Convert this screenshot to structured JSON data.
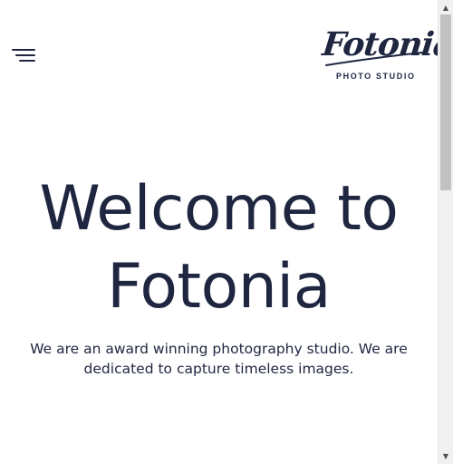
{
  "header": {
    "menu_icon": "hamburger-menu-icon",
    "logo": {
      "name": "Fotonia",
      "tagline": "PHOTO STUDIO"
    }
  },
  "hero": {
    "title_line1": "Welcome to",
    "title_line2": "Fotonia",
    "subtitle_line1": "We are an award winning photography studio. We are",
    "subtitle_line2": "dedicated to capture timeless images."
  },
  "scrollbar": {
    "up_icon": "scroll-up-arrow-icon",
    "down_icon": "scroll-down-arrow-icon"
  },
  "colors": {
    "text": "#1f2640",
    "background": "#ffffff",
    "scrollbar_track": "#f1f1f1",
    "scrollbar_thumb": "#c1c1c1"
  }
}
